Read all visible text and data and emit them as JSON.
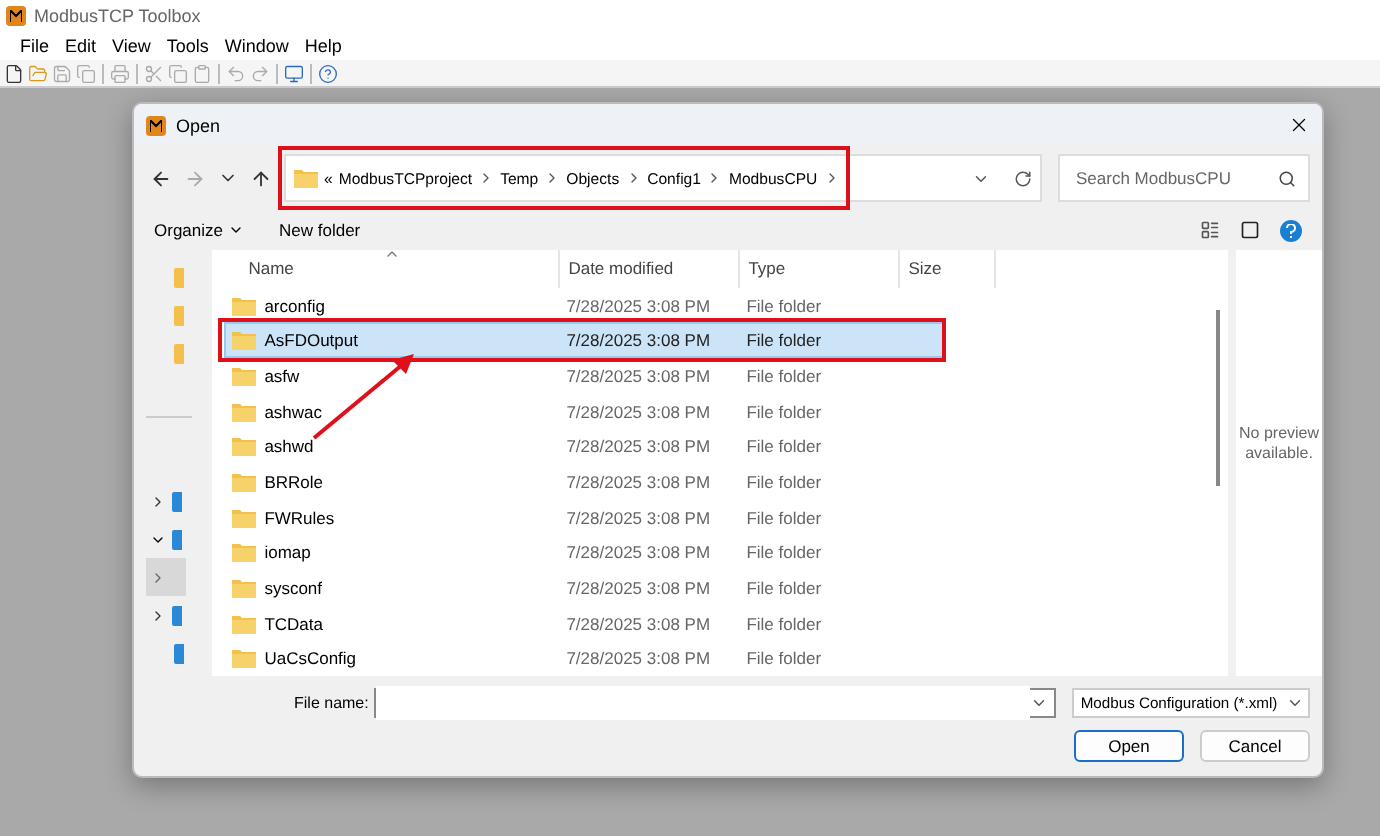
{
  "app": {
    "title": "ModbusTCP Toolbox"
  },
  "menu": [
    "File",
    "Edit",
    "View",
    "Tools",
    "Window",
    "Help"
  ],
  "toolbar": [
    {
      "kind": "new",
      "disabled": false
    },
    {
      "kind": "open",
      "disabled": false
    },
    {
      "kind": "save",
      "disabled": true
    },
    {
      "kind": "saveall",
      "disabled": true
    },
    {
      "kind": "sep"
    },
    {
      "kind": "print",
      "disabled": true
    },
    {
      "kind": "sep"
    },
    {
      "kind": "cut",
      "disabled": true
    },
    {
      "kind": "copy",
      "disabled": true
    },
    {
      "kind": "paste",
      "disabled": true
    },
    {
      "kind": "sep"
    },
    {
      "kind": "undo",
      "disabled": true
    },
    {
      "kind": "redo",
      "disabled": true
    },
    {
      "kind": "sep"
    },
    {
      "kind": "monitor",
      "disabled": false
    },
    {
      "kind": "sep"
    },
    {
      "kind": "help",
      "disabled": false
    }
  ],
  "dialog": {
    "title": "Open",
    "breadcrumb": {
      "overflow": "«",
      "parts": [
        "ModbusTCPproject",
        "Temp",
        "Objects",
        "Config1",
        "ModbusCPU"
      ],
      "outlined": true
    },
    "search": {
      "placeholder": "Search ModbusCPU"
    },
    "commands": [
      {
        "label": "Organize",
        "dropdown": true
      },
      {
        "label": "New folder",
        "dropdown": false
      }
    ],
    "nav_pane": [
      {
        "kind": "quick"
      },
      {
        "kind": "quick"
      },
      {
        "kind": "quick"
      },
      {
        "kind": "divider"
      },
      {
        "kind": "tree",
        "expanded": false,
        "selected": false
      },
      {
        "kind": "tree",
        "expanded": true,
        "selected": false
      },
      {
        "kind": "tree",
        "expanded": false,
        "selected": true
      },
      {
        "kind": "tree",
        "expanded": false,
        "selected": false
      },
      {
        "kind": "leaf"
      }
    ],
    "columns": [
      "Name",
      "Date modified",
      "Type",
      "Size"
    ],
    "rows": [
      {
        "name": "arconfig",
        "date": "7/28/2025 3:08 PM",
        "type": "File folder",
        "selected": false,
        "outlined": false
      },
      {
        "name": "AsFDOutput",
        "date": "7/28/2025 3:08 PM",
        "type": "File folder",
        "selected": true,
        "outlined": true
      },
      {
        "name": "asfw",
        "date": "7/28/2025 3:08 PM",
        "type": "File folder",
        "selected": false,
        "outlined": false
      },
      {
        "name": "ashwac",
        "date": "7/28/2025 3:08 PM",
        "type": "File folder",
        "selected": false,
        "outlined": false
      },
      {
        "name": "ashwd",
        "date": "7/28/2025 3:08 PM",
        "type": "File folder",
        "selected": false,
        "outlined": false
      },
      {
        "name": "BRRole",
        "date": "7/28/2025 3:08 PM",
        "type": "File folder",
        "selected": false,
        "outlined": false
      },
      {
        "name": "FWRules",
        "date": "7/28/2025 3:08 PM",
        "type": "File folder",
        "selected": false,
        "outlined": false
      },
      {
        "name": "iomap",
        "date": "7/28/2025 3:08 PM",
        "type": "File folder",
        "selected": false,
        "outlined": false
      },
      {
        "name": "sysconf",
        "date": "7/28/2025 3:08 PM",
        "type": "File folder",
        "selected": false,
        "outlined": false
      },
      {
        "name": "TCData",
        "date": "7/28/2025 3:08 PM",
        "type": "File folder",
        "selected": false,
        "outlined": false
      },
      {
        "name": "UaCsConfig",
        "date": "7/28/2025 3:08 PM",
        "type": "File folder",
        "selected": false,
        "outlined": false
      }
    ],
    "preview": "No preview available.",
    "file_name_label": "File name:",
    "file_type": "Modbus Configuration (*.xml)",
    "buttons": [
      {
        "label": "Open",
        "default": true
      },
      {
        "label": "Cancel",
        "default": false
      }
    ]
  }
}
